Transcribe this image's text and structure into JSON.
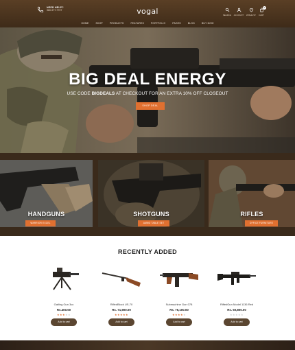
{
  "header": {
    "logo": "vogal",
    "phone_title": "NEED HELP?",
    "phone_number": "980-977-7797",
    "utilities": [
      {
        "label": "SEARCH",
        "icon": "search-icon"
      },
      {
        "label": "ACCOUNT",
        "icon": "user-icon"
      },
      {
        "label": "WISHLIST",
        "icon": "heart-icon"
      },
      {
        "label": "CART",
        "icon": "bag-icon",
        "count": "0"
      }
    ]
  },
  "nav": [
    "HOME",
    "SHOP",
    "PRODUCTS",
    "FEATURES",
    "PORTFOLIO",
    "PAGES",
    "BLOG",
    "BUY NOW"
  ],
  "hero": {
    "title": "BIG DEAL ENERGY",
    "sub_prefix": "USE CODE ",
    "code": "BIGDEALS",
    "sub_suffix": " AT CHECKOUT FOR AN EXTRA 10% OFF CLOSEOUT",
    "button": "SHOP DEAL"
  },
  "categories": [
    {
      "title": "HANDGUNS",
      "button": "WARRIOR EXCEL"
    },
    {
      "title": "SHOTGUNS",
      "button": "AMMO TABLE SET"
    },
    {
      "title": "RIFLES",
      "button": "OFFICE FURNITURE"
    }
  ],
  "recent": {
    "title": "RECENTLY ADDED",
    "products": [
      {
        "name": "Gatling Gun 3cc",
        "price": "Rs.400.00",
        "rating": 3,
        "button": "Add to cart"
      },
      {
        "name": "RifledBlock US-70",
        "price": "Rs. 71,900.00",
        "rating": 5,
        "button": "Add to cart"
      },
      {
        "name": "Submachine Gun 078",
        "price": "Rs. 76,100.00",
        "rating": 4,
        "button": "Add to cart"
      },
      {
        "name": "RiffedGun Model 1136 Red",
        "price": "Rs. 50,800.00",
        "rating": 0,
        "button": "Add to cart"
      }
    ]
  },
  "colors": {
    "accent": "#e07030",
    "header": "#4a3420",
    "button_dark": "#5b4631"
  }
}
